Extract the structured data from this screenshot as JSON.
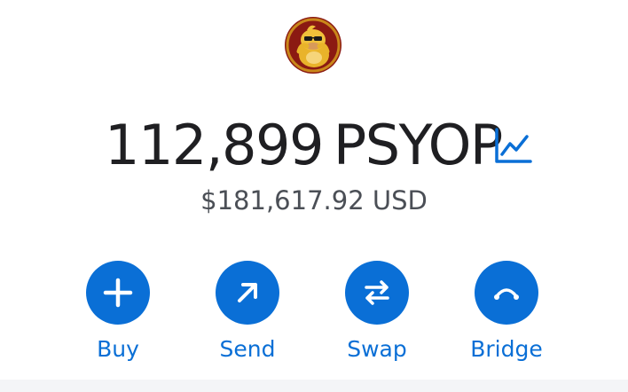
{
  "token": {
    "avatar_icon": "psyop-token-logo-icon",
    "amount": "112,899",
    "symbol": "PSYOP",
    "fiat_value": "$181,617.92 USD",
    "chart_icon": "price-chart-icon"
  },
  "actions": [
    {
      "label": "Buy",
      "icon": "plus-icon"
    },
    {
      "label": "Send",
      "icon": "arrow-up-right-icon"
    },
    {
      "label": "Swap",
      "icon": "swap-arrows-icon"
    },
    {
      "label": "Bridge",
      "icon": "bridge-icon"
    }
  ],
  "colors": {
    "accent": "#0a6fd6",
    "text_primary": "#1f1f22",
    "text_secondary": "#4b4f56",
    "background": "#ffffff"
  }
}
